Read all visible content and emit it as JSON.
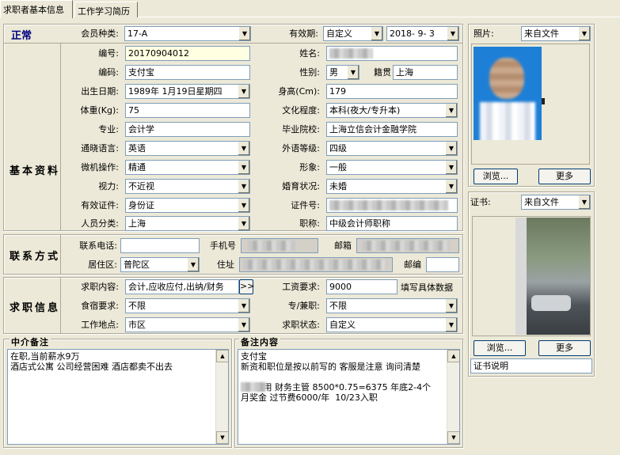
{
  "tabs": [
    "求职者基本信息",
    "工作学习简历"
  ],
  "status": "正常",
  "header": {
    "member_type_label": "会员种类:",
    "member_type_value": "17-A",
    "validity_label": "有效期:",
    "validity_mode": "自定义",
    "validity_date": "2018- 9- 3"
  },
  "sections": {
    "basic": "基本资料",
    "contact": "联系方式",
    "jobinfo": "求职信息"
  },
  "basic": {
    "number_label": "编号:",
    "number_value": "20170904012",
    "name_label": "姓名:",
    "name_value": "",
    "code_label": "编码:",
    "code_value": "支付宝",
    "gender_label": "性别:",
    "gender_value": "男",
    "native_label": "籍贯",
    "native_value": "上海",
    "birth_label": "出生日期:",
    "birth_value": "1989年 1月19日星期四",
    "height_label": "身高(Cm):",
    "height_value": "179",
    "weight_label": "体重(Kg):",
    "weight_value": "75",
    "education_label": "文化程度:",
    "education_value": "本科(夜大/专升本)",
    "major_label": "专业:",
    "major_value": "会计学",
    "school_label": "毕业院校:",
    "school_value": "上海立信会计金融学院",
    "language_label": "通晓语言:",
    "language_value": "英语",
    "language_level_label": "外语等级:",
    "language_level_value": "四级",
    "computer_label": "微机操作:",
    "computer_value": "精通",
    "image_label": "形象:",
    "image_value": "一般",
    "vision_label": "视力:",
    "vision_value": "不近视",
    "marital_label": "婚育状况:",
    "marital_value": "未婚",
    "id_type_label": "有效证件:",
    "id_type_value": "身份证",
    "id_number_label": "证件号:",
    "id_number_value": "",
    "category_label": "人员分类:",
    "category_value": "上海",
    "title_label": "职称:",
    "title_value": "中级会计师职称"
  },
  "contact": {
    "phone_label": "联系电话:",
    "phone_value": "",
    "mobile_label": "手机号",
    "email_label": "邮箱",
    "district_label": "居住区:",
    "district_value": "普陀区",
    "address_label": "住址",
    "zip_label": "邮编",
    "zip_value": ""
  },
  "job": {
    "content_label": "求职内容:",
    "content_value": "会计,应收应付,出纳/财务",
    "more_button": ">>",
    "salary_label": "工资要求:",
    "salary_value": "9000",
    "salary_hint": "填写具体数据",
    "board_label": "食宿要求:",
    "board_value": "不限",
    "parttime_label": "专/兼职:",
    "parttime_value": "不限",
    "location_label": "工作地点:",
    "location_value": "市区",
    "status_label": "求职状态:",
    "status_value": "自定义"
  },
  "photo": {
    "label": "照片:",
    "source": "来自文件",
    "browse": "浏览...",
    "more": "更多"
  },
  "cert": {
    "label": "证书:",
    "source": "来自文件",
    "browse": "浏览...",
    "more": "更多",
    "desc": "证书说明"
  },
  "notes": {
    "agency_title": "中介备注",
    "agency_text": "在职,当前薪水9万\n酒店式公寓 公司经营困难 酒店都卖不出去",
    "remark_title": "备注内容",
    "remark_text": "支付宝\n新资和职位是按以前写的 客服是注意 询问清楚\n\n     录用 财务主管 8500*0.75=6375 年底2-4个\n月奖金 过节费6000/年  10/23入职"
  },
  "colors": {
    "status": "#000080",
    "background": "#ece9d8",
    "input_border": "#7f9db9",
    "highlight": "#ffffe1"
  }
}
